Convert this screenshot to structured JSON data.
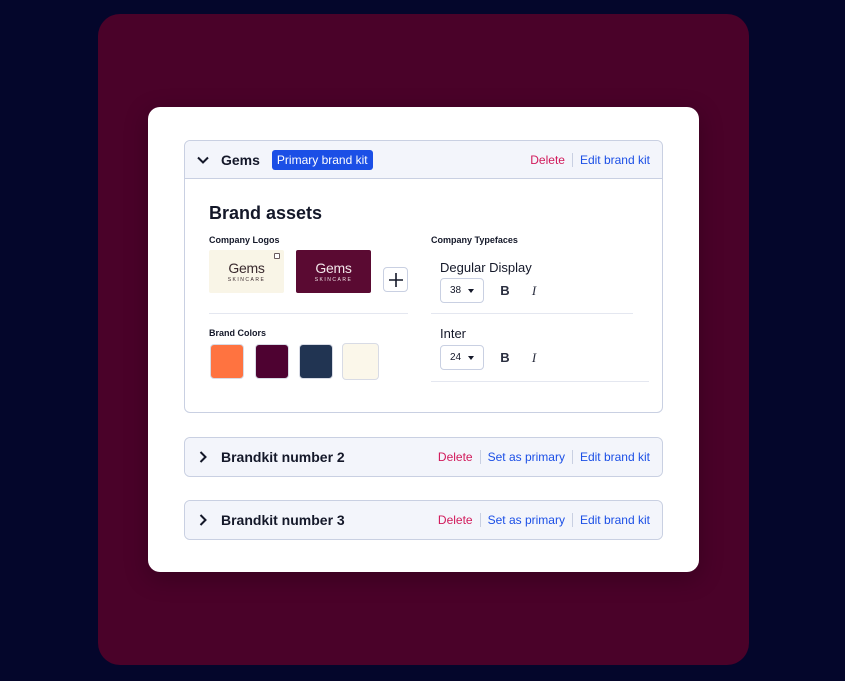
{
  "colors": {
    "page_bg": "#04062b",
    "backdrop": "#4a0229",
    "accent": "#1b4fe6",
    "danger": "#d1195a"
  },
  "kits": [
    {
      "name": "Gems",
      "badge": "Primary brand kit",
      "expanded": true,
      "chevron_icon": "chevron-down-icon",
      "actions": {
        "delete": "Delete",
        "edit": "Edit brand kit"
      }
    },
    {
      "name": "Brandkit number 2",
      "expanded": false,
      "chevron_icon": "chevron-right-icon",
      "actions": {
        "delete": "Delete",
        "set_primary": "Set as primary",
        "edit": "Edit brand kit"
      }
    },
    {
      "name": "Brandkit number 3",
      "expanded": false,
      "chevron_icon": "chevron-right-icon",
      "actions": {
        "delete": "Delete",
        "set_primary": "Set as primary",
        "edit": "Edit brand kit"
      }
    }
  ],
  "assets": {
    "title": "Brand assets",
    "logos": {
      "label": "Company Logos",
      "items": [
        {
          "word": "Gems",
          "tag": "SKINCARE",
          "bg": "#f9f5e7"
        },
        {
          "word": "Gems",
          "tag": "SKINCARE",
          "bg": "#5a0a32"
        }
      ],
      "add_icon": "plus-icon"
    },
    "colors": {
      "label": "Brand Colors",
      "swatches": [
        "#ff7340",
        "#4e0231",
        "#213452",
        "#fbf7ea"
      ]
    },
    "typefaces": {
      "label": "Company Typefaces",
      "items": [
        {
          "name": "Degular Display",
          "size": "38",
          "bold": "B",
          "italic": "I"
        },
        {
          "name": "Inter",
          "size": "24",
          "bold": "B",
          "italic": "I"
        }
      ]
    }
  }
}
